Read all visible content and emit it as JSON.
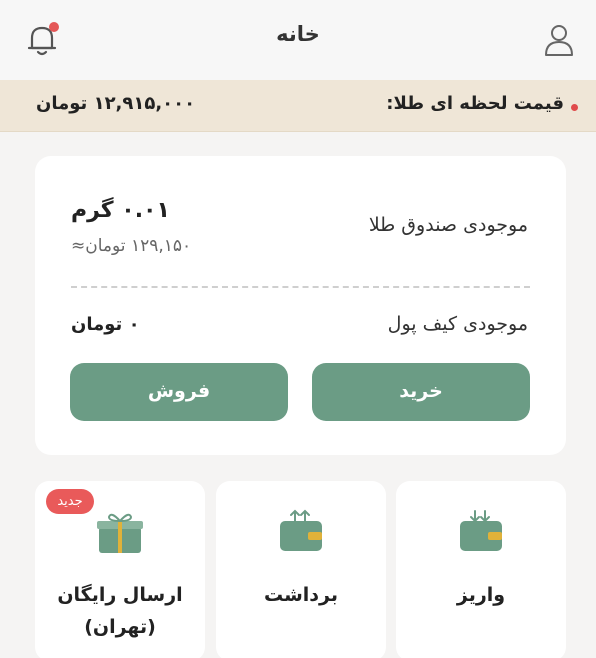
{
  "header": {
    "title": "خانه",
    "bell_icon": "bell-icon",
    "user_icon": "user-icon",
    "notification_color": "#e45757"
  },
  "price_bar": {
    "label": "قیمت لحظه ای طلا:",
    "price": "۱۲,۹۱۵,۰۰۰ تومان"
  },
  "balance_card": {
    "gold_label": "موجودی صندوق طلا",
    "gold_amount": "۰.۰۱ گرم",
    "gold_toman": "۱۲۹,۱۵۰ تومان≈",
    "wallet_label": "موجودی کیف پول",
    "wallet_amount": "۰ تومان",
    "buy_label": "خرید",
    "sell_label": "فروش"
  },
  "tiles": [
    {
      "label": "واریز",
      "icon": "wallet-deposit-icon"
    },
    {
      "label": "برداشت",
      "icon": "wallet-withdraw-icon"
    },
    {
      "label_line1": "ارسال رایگان",
      "label_line2": "(تهران)",
      "icon": "gift-icon",
      "badge": "جدید"
    }
  ],
  "colors": {
    "accent": "#6b9c85",
    "price_bar_bg": "#efe6d7",
    "badge": "#e95a5a",
    "icon_gold": "#e0b23a"
  }
}
